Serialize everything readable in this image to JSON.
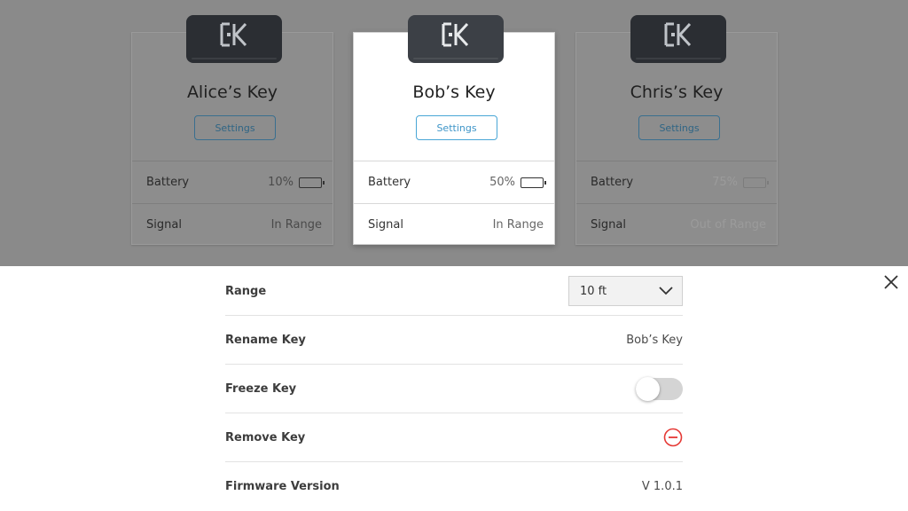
{
  "keys": [
    {
      "name": "Alice’s Key",
      "settings_label": "Settings",
      "battery_label": "Battery",
      "battery_value": "10%",
      "battery_level": 0.1,
      "battery_color": "#d62b2b",
      "signal_label": "Signal",
      "signal_value": "In Range"
    },
    {
      "name": "Bob’s Key",
      "settings_label": "Settings",
      "battery_label": "Battery",
      "battery_value": "50%",
      "battery_level": 0.5,
      "battery_color": "#38c25a",
      "signal_label": "Signal",
      "signal_value": "In Range"
    },
    {
      "name": "Chris’s Key",
      "settings_label": "Settings",
      "battery_label": "Battery",
      "battery_value": "75%",
      "battery_level": 0.75,
      "battery_color": "#6e6e6e",
      "signal_label": "Signal",
      "signal_value": "Out of Range"
    }
  ],
  "settings": {
    "range_label": "Range",
    "range_value": "10 ft",
    "rename_label": "Rename Key",
    "rename_value": "Bob’s Key",
    "freeze_label": "Freeze Key",
    "freeze_on": false,
    "remove_label": "Remove Key",
    "firmware_label": "Firmware Version",
    "firmware_value": "V 1.0.1"
  },
  "colors": {
    "accent": "#49a6d6",
    "danger": "#e53935",
    "overlay": "#8a8a8a"
  },
  "icons": {
    "close": "close-icon",
    "dropdown": "chevron-down-icon",
    "remove": "minus-circle-icon",
    "logo": "ek-logo-icon",
    "battery": "battery-icon"
  }
}
